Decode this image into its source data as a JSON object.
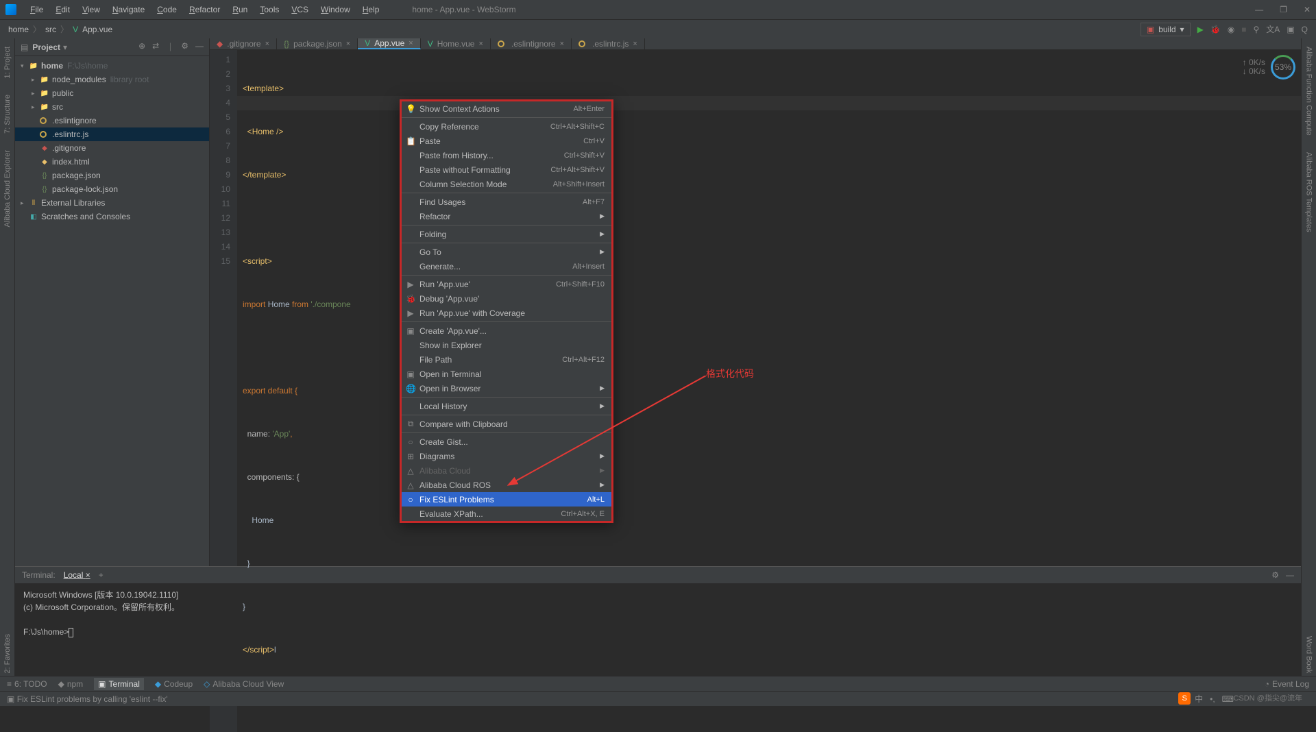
{
  "window": {
    "title": "home - App.vue - WebStorm"
  },
  "menus": [
    "File",
    "Edit",
    "View",
    "Navigate",
    "Code",
    "Refactor",
    "Run",
    "Tools",
    "VCS",
    "Window",
    "Help"
  ],
  "breadcrumb": [
    "home",
    "src",
    "App.vue"
  ],
  "run_config": "build",
  "sidebar": {
    "title": "Project",
    "tree": {
      "root": "home",
      "root_path": "F:\\Js\\home",
      "node_modules": "node_modules",
      "node_modules_hint": "library root",
      "public": "public",
      "src": "src",
      "eslintignore": ".eslintignore",
      "eslintrc": ".eslintrc.js",
      "gitignore": ".gitignore",
      "indexhtml": "index.html",
      "packagejson": "package.json",
      "packagelock": "package-lock.json",
      "extlib": "External Libraries",
      "scratch": "Scratches and Consoles"
    }
  },
  "tabs": [
    {
      "label": ".gitignore",
      "icon": "git"
    },
    {
      "label": "package.json",
      "icon": "json"
    },
    {
      "label": "App.vue",
      "icon": "vue",
      "active": true
    },
    {
      "label": "Home.vue",
      "icon": "vue"
    },
    {
      "label": ".eslintignore",
      "icon": "circ"
    },
    {
      "label": ".eslintrc.js",
      "icon": "circ"
    }
  ],
  "gutter": [
    "1",
    "2",
    "3",
    "4",
    "5",
    "6",
    "7",
    "8",
    "9",
    "10",
    "11",
    "12",
    "13",
    "14",
    "15"
  ],
  "code": {
    "l1a": "<",
    "l1b": "template",
    "l1c": ">",
    "l2a": "<",
    "l2b": "Home ",
    "l2c": "/>",
    "l3a": "</",
    "l3b": "template",
    "l3c": ">",
    "l5a": "<",
    "l5b": "script",
    "l5c": ">",
    "l6a": "import ",
    "l6b": "Home ",
    "l6c": "from ",
    "l6d": "'./compone",
    "l8": "export default {",
    "l9a": "name: ",
    "l9b": "'App'",
    "l9c": ",",
    "l10": "components: {",
    "l11": "Home",
    "l12": "}",
    "l13": "}",
    "l14a": "</",
    "l14b": "script",
    "l14c": ">",
    "l14d": "l"
  },
  "context_menu": [
    {
      "type": "item",
      "label": "Show Context Actions",
      "sc": "Alt+Enter",
      "icon": "💡"
    },
    {
      "type": "sep"
    },
    {
      "type": "item",
      "label": "Copy Reference",
      "sc": "Ctrl+Alt+Shift+C"
    },
    {
      "type": "item",
      "label": "Paste",
      "sc": "Ctrl+V",
      "icon": "📋"
    },
    {
      "type": "item",
      "label": "Paste from History...",
      "sc": "Ctrl+Shift+V"
    },
    {
      "type": "item",
      "label": "Paste without Formatting",
      "sc": "Ctrl+Alt+Shift+V"
    },
    {
      "type": "item",
      "label": "Column Selection Mode",
      "sc": "Alt+Shift+Insert"
    },
    {
      "type": "sep"
    },
    {
      "type": "item",
      "label": "Find Usages",
      "sc": "Alt+F7"
    },
    {
      "type": "item",
      "label": "Refactor",
      "sub": true
    },
    {
      "type": "sep"
    },
    {
      "type": "item",
      "label": "Folding",
      "sub": true
    },
    {
      "type": "sep"
    },
    {
      "type": "item",
      "label": "Go To",
      "sub": true
    },
    {
      "type": "item",
      "label": "Generate...",
      "sc": "Alt+Insert"
    },
    {
      "type": "sep"
    },
    {
      "type": "item",
      "label": "Run 'App.vue'",
      "sc": "Ctrl+Shift+F10",
      "icon": "▶"
    },
    {
      "type": "item",
      "label": "Debug 'App.vue'",
      "icon": "🐞"
    },
    {
      "type": "item",
      "label": "Run 'App.vue' with Coverage",
      "icon": "▶"
    },
    {
      "type": "sep"
    },
    {
      "type": "item",
      "label": "Create 'App.vue'...",
      "icon": "▣"
    },
    {
      "type": "item",
      "label": "Show in Explorer"
    },
    {
      "type": "item",
      "label": "File Path",
      "sc": "Ctrl+Alt+F12"
    },
    {
      "type": "item",
      "label": "Open in Terminal",
      "icon": "▣"
    },
    {
      "type": "item",
      "label": "Open in Browser",
      "sub": true,
      "icon": "🌐"
    },
    {
      "type": "sep"
    },
    {
      "type": "item",
      "label": "Local History",
      "sub": true
    },
    {
      "type": "sep"
    },
    {
      "type": "item",
      "label": "Compare with Clipboard",
      "icon": "⧉"
    },
    {
      "type": "sep"
    },
    {
      "type": "item",
      "label": "Create Gist...",
      "icon": "○"
    },
    {
      "type": "item",
      "label": "Diagrams",
      "sub": true,
      "icon": "⊞"
    },
    {
      "type": "item",
      "label": "Alibaba Cloud",
      "sub": true,
      "disabled": true,
      "icon": "△"
    },
    {
      "type": "item",
      "label": "Alibaba Cloud ROS",
      "sub": true,
      "icon": "△"
    },
    {
      "type": "item",
      "label": "Fix ESLint Problems",
      "sc": "Alt+L",
      "sel": true,
      "icon": "○"
    },
    {
      "type": "item",
      "label": "Evaluate XPath...",
      "sc": "Ctrl+Alt+X, E"
    }
  ],
  "terminal": {
    "title": "Terminal:",
    "tab": "Local",
    "line1": "Microsoft Windows [版本 10.0.19042.1110]",
    "line2": "(c) Microsoft Corporation。保留所有权利。",
    "prompt": "F:\\Js\\home>"
  },
  "bottom": {
    "todo": "6: TODO",
    "npm": "npm",
    "terminal": "Terminal",
    "codeup": "Codeup",
    "aliview": "Alibaba Cloud View",
    "eventlog": "Event Log"
  },
  "status": {
    "msg": "Fix ESLint problems by calling 'eslint --fix'"
  },
  "annotation": "格式化代码",
  "perf": {
    "up": "0K/s",
    "down": "0K/s",
    "pct": "53%"
  },
  "leftstrip": [
    "1: Project",
    "7: Structure",
    "Alibaba Cloud Explorer"
  ],
  "rightstrip": [
    "Alibaba Function Compute",
    "Alibaba ROS Templates",
    "Word Book"
  ],
  "rightstrip2": "2: Favorites",
  "watermark": "CSDN @指尖@流年"
}
